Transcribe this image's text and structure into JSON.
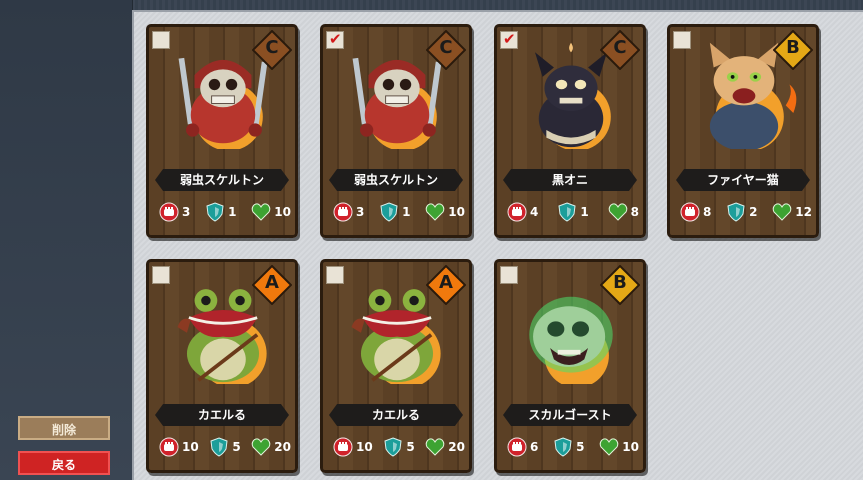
{
  "sidebar": {
    "delete_label": "削除",
    "back_label": "戻る"
  },
  "cards": [
    {
      "name": "弱虫スケルトン",
      "rank": "C",
      "checked": false,
      "attack": "3",
      "defense": "1",
      "hp": "10",
      "monster": "skeleton"
    },
    {
      "name": "弱虫スケルトン",
      "rank": "C",
      "checked": true,
      "attack": "3",
      "defense": "1",
      "hp": "10",
      "monster": "skeleton"
    },
    {
      "name": "黒オニ",
      "rank": "C",
      "checked": true,
      "attack": "4",
      "defense": "1",
      "hp": "8",
      "monster": "black-oni"
    },
    {
      "name": "ファイヤー猫",
      "rank": "B",
      "checked": false,
      "attack": "8",
      "defense": "2",
      "hp": "12",
      "monster": "fire-cat"
    },
    {
      "name": "カエルる",
      "rank": "A",
      "checked": false,
      "attack": "10",
      "defense": "5",
      "hp": "20",
      "monster": "frog"
    },
    {
      "name": "カエルる",
      "rank": "A",
      "checked": false,
      "attack": "10",
      "defense": "5",
      "hp": "20",
      "monster": "frog"
    },
    {
      "name": "スカルゴースト",
      "rank": "B",
      "checked": false,
      "attack": "6",
      "defense": "5",
      "hp": "10",
      "monster": "skull-ghost"
    }
  ],
  "colors": {
    "rank_C": "#8a4f22",
    "rank_B": "#e4a816",
    "rank_A": "#f0790d",
    "attack": "#d0222b",
    "defense": "#1c9e9a",
    "hp": "#3da332"
  }
}
